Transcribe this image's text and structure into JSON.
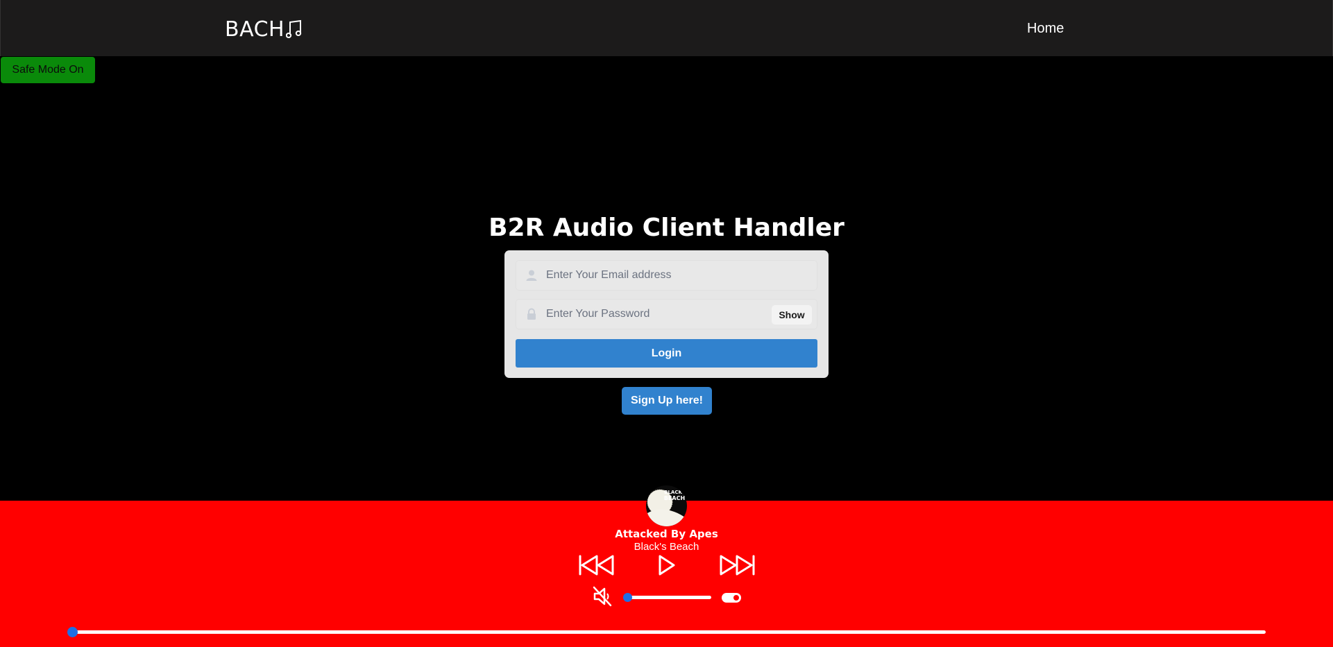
{
  "navbar": {
    "brand": "BACH",
    "brand_icon": "music-note-icon",
    "home_link": "Home"
  },
  "safe_mode": {
    "label": "Safe Mode On",
    "color": "#0a8a0a"
  },
  "login": {
    "title": "B2R Audio Client Handler",
    "email_placeholder": "Enter Your Email address",
    "email_value": "",
    "password_placeholder": "Enter Your Password",
    "password_value": "",
    "show_label": "Show",
    "login_label": "Login",
    "accent_color": "#3182ce"
  },
  "signup": {
    "label": "Sign Up here!"
  },
  "player": {
    "background_color": "#ff0000",
    "track_title": "Attacked By Apes",
    "artist": "Black's Beach",
    "album_art_text": "BLACK BEACH",
    "muted": true,
    "volume_fraction": 0.0,
    "loop_toggle_on": true,
    "progress_fraction": 0.0,
    "icons": [
      "skip-back-icon",
      "play-icon",
      "skip-forward-icon",
      "volume-muted-icon"
    ]
  }
}
